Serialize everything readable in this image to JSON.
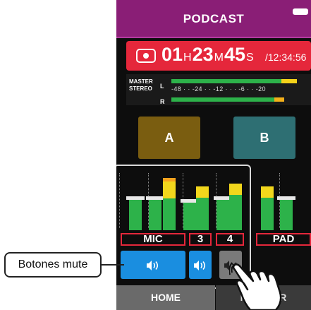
{
  "screen": {
    "title": "PODCAST",
    "timer": {
      "hours": "01",
      "h_unit": "H",
      "minutes": "23",
      "m_unit": "M",
      "seconds": "45",
      "s_unit": "S",
      "total": "/12:34:56"
    },
    "master": {
      "label_line1": "MASTER",
      "label_line2": "STEREO",
      "left": "L",
      "right": "R",
      "scale": "-48 · · -24 · · -12 · · · -6 · · -20"
    },
    "buttons": {
      "a": "A",
      "b": "B"
    },
    "channels": [
      "MIC",
      "3",
      "4",
      "PAD"
    ],
    "tabs": {
      "home": "HOME",
      "monitor": "MONITOR"
    }
  },
  "annotation": {
    "callout": "Botones mute"
  },
  "colors": {
    "title_bar": "#8a1e76",
    "record": "#e5273b",
    "mute_on": "#1a8ee0",
    "mute_off": "#7a7a7a",
    "button_a": "#7a5d10",
    "button_b": "#2e6f73"
  },
  "icons": {
    "speaker": "speaker-icon",
    "muted": "speaker-muted-icon",
    "record": "record-icon",
    "battery": "battery-icon",
    "hand": "pointing-hand-icon"
  }
}
